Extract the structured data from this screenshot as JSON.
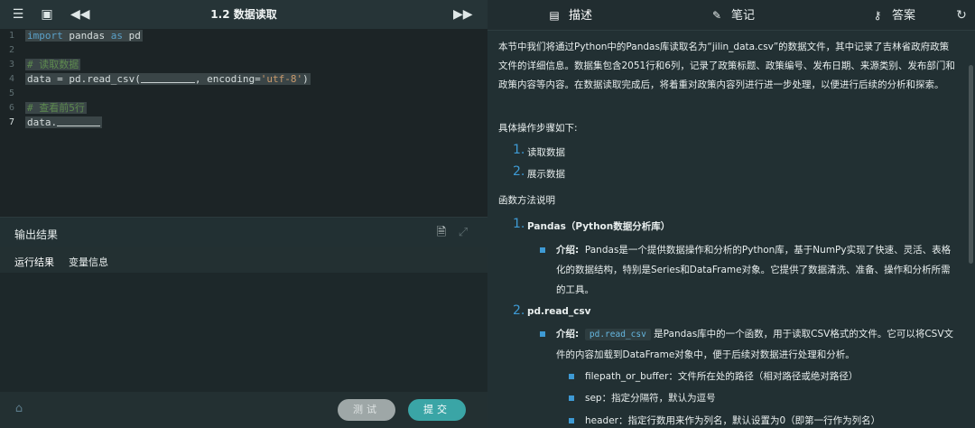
{
  "toolbar": {
    "title": "1.2 数据读取",
    "icons": [
      "menu-icon",
      "screen-icon",
      "prev-icon",
      "next-icon"
    ]
  },
  "editor": {
    "line_numbers": [
      "1",
      "2",
      "3",
      "4",
      "5",
      "6",
      "7"
    ],
    "active_line": "7",
    "line1_kw1": "import",
    "line1_mid": " pandas ",
    "line1_kw2": "as",
    "line1_end": " pd",
    "line3": "# 读取数据",
    "line4_pre": "data = pd.read_csv(",
    "line4_mid": ", encoding=",
    "line4_str": "'utf-8'",
    "line4_end": ")",
    "line6": "# 查看前5行",
    "line7_pre": "data."
  },
  "output": {
    "title": "输出结果",
    "tabs": [
      "运行结果",
      "变量信息"
    ],
    "active_tab": "运行结果"
  },
  "buttons": {
    "test": "测试",
    "submit": "提交"
  },
  "right_tabs": {
    "describe": "描述",
    "notes": "笔记",
    "answer": "答案",
    "active": "描述"
  },
  "content": {
    "intro": "本节中我们将通过Python中的Pandas库读取名为“jilin_data.csv”的数据文件，其中记录了吉林省政府政策文件的详细信息。数据集包含2051行和6列，记录了政策标题、政策编号、发布日期、来源类别、发布部门和政策内容等内容。在数据读取完成后，将着重对政策内容列进行进一步处理，以便进行后续的分析和探索。",
    "steps_title": "具体操作步骤如下:",
    "steps": [
      {
        "num": "1.",
        "text": "读取数据"
      },
      {
        "num": "2.",
        "text": "展示数据"
      }
    ],
    "func_title": "函数方法说明",
    "funcs": [
      {
        "num": "1.",
        "name": "Pandas（Python数据分析库）",
        "intro_label": "介绍:",
        "intro_text": "Pandas是一个提供数据操作和分析的Python库，基于NumPy实现了快速、灵活、表格化的数据结构，特别是Series和DataFrame对象。它提供了数据清洗、准备、操作和分析所需的工具。"
      },
      {
        "num": "2.",
        "name": "pd.read_csv",
        "intro_label": "介绍:",
        "code": "pd.read_csv",
        "intro_text": "是Pandas库中的一个函数，用于读取CSV格式的文件。它可以将CSV文件的内容加载到DataFrame对象中，便于后续对数据进行处理和分析。",
        "params": [
          "filepath_or_buffer：文件所在处的路径（相对路径或绝对路径）",
          "sep：指定分隔符，默认为逗号",
          "header：指定行数用来作为列名，默认设置为0（即第一行作为列名）"
        ]
      }
    ]
  }
}
